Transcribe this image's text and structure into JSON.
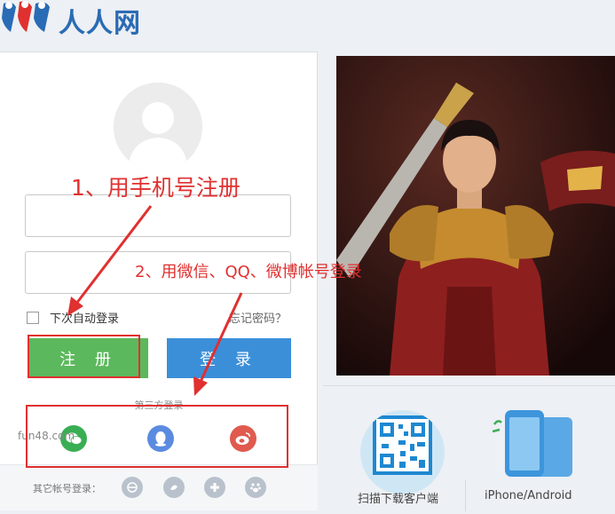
{
  "header": {
    "logo_text": "人人网"
  },
  "login": {
    "auto_login_label": "下次自动登录",
    "forgot_password": "忘记密码？",
    "register_button": "注 册",
    "login_button": "登 录",
    "third_party_title": "第三方登录",
    "third_party": [
      "wechat-icon",
      "qq-icon",
      "weibo-icon"
    ],
    "other_accounts_label": "其它帐号登录：",
    "other_accounts": [
      "china-mobile-icon",
      "tianyi-icon",
      "plus-icon",
      "paw-icon"
    ]
  },
  "watermark": "fun48.com",
  "apps": {
    "scan_label": "扫描下载客户端",
    "phone_label": "iPhone/Android"
  },
  "annotations": {
    "step1": "1、用手机号注册",
    "step2": "2、用微信、QQ、微博帐号登录"
  },
  "colors": {
    "brand_blue": "#2a6bb5",
    "register_green": "#5cb85c",
    "login_blue": "#3b8fd9",
    "annotation_red": "#e03030"
  }
}
